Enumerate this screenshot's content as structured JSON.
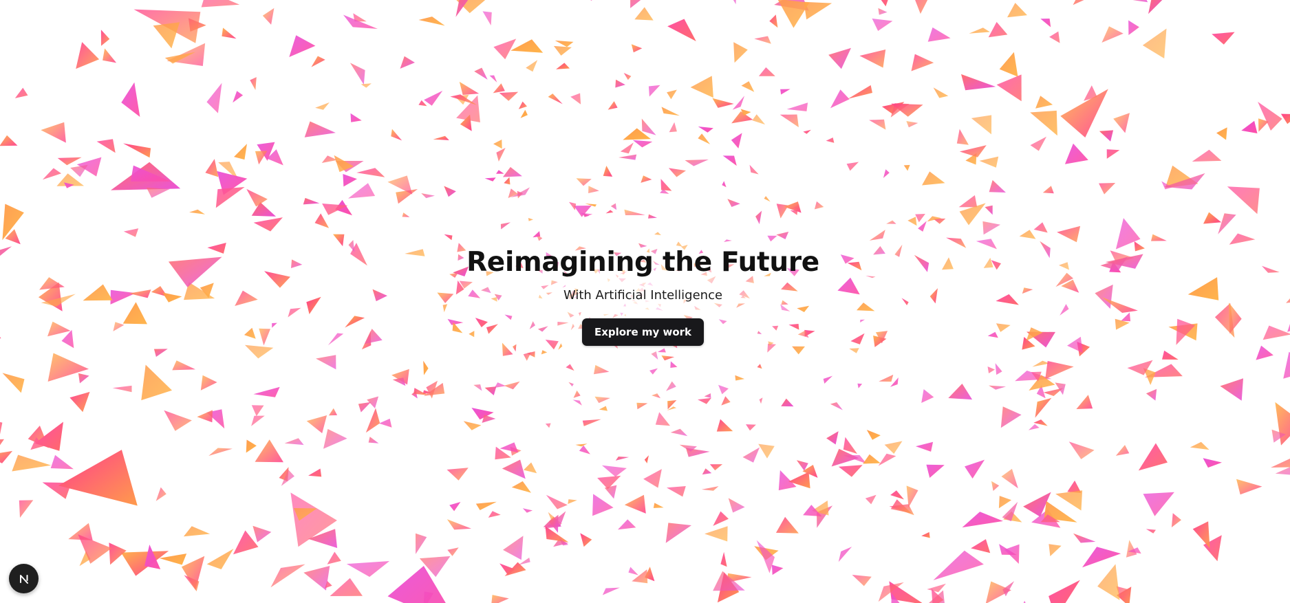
{
  "hero": {
    "title": "Reimagining the Future",
    "subtitle": "With Artificial Intelligence",
    "cta_label": "Explore my work"
  },
  "dev_badge": {
    "icon": "nextjs-logo-icon",
    "letter": "N"
  },
  "background": {
    "effect": "scattered triangular shards",
    "colors": [
      "#ff4fa3",
      "#ff3d8b",
      "#ff6a6a",
      "#ff9a4a",
      "#e94fd8",
      "#ffb347"
    ]
  },
  "theme": {
    "page_bg": "#ffffff",
    "title_color": "#111111",
    "button_bg": "#18181b",
    "button_text": "#ffffff",
    "badge_bg": "#1f1f1f"
  }
}
